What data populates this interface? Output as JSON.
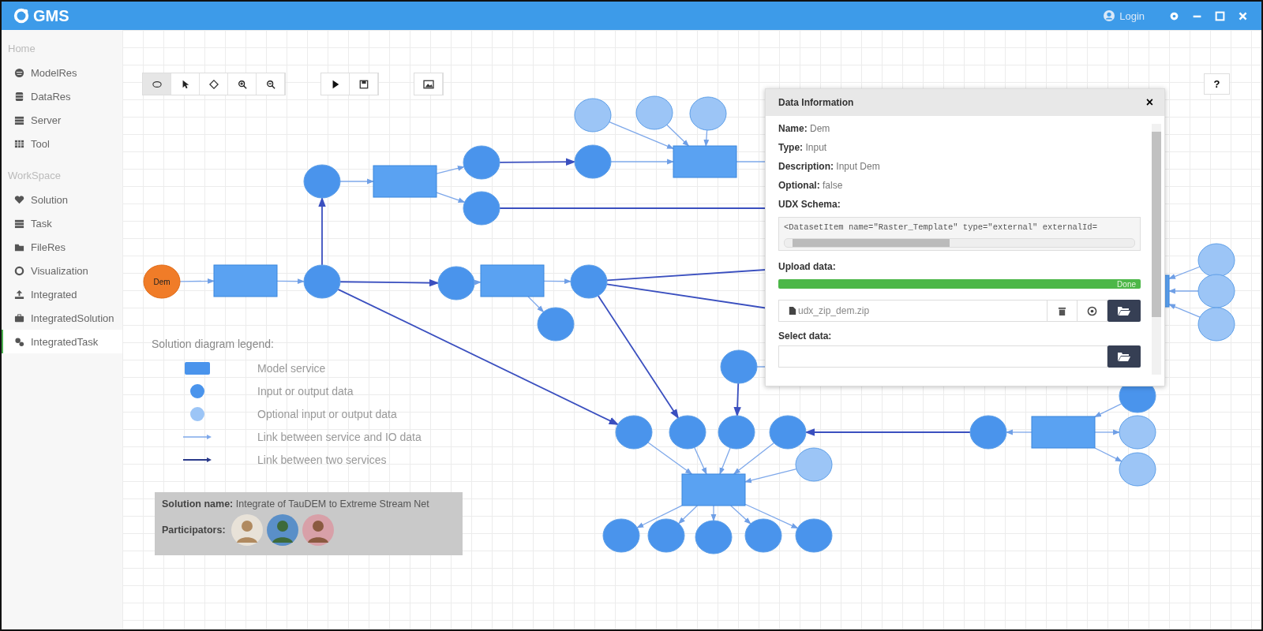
{
  "app": {
    "logo": "GMS",
    "login": "Login"
  },
  "sidebar": [
    {
      "title": "Home",
      "items": [
        {
          "label": "ModelRes",
          "selected": false
        },
        {
          "label": "DataRes",
          "selected": false
        },
        {
          "label": "Server",
          "selected": false
        },
        {
          "label": "Tool",
          "selected": false
        }
      ]
    },
    {
      "title": "WorkSpace",
      "items": [
        {
          "label": "Solution",
          "selected": false
        },
        {
          "label": "Task",
          "selected": false
        },
        {
          "label": "FileRes",
          "selected": false
        },
        {
          "label": "Visualization",
          "selected": false
        },
        {
          "label": "Integrated",
          "selected": false
        },
        {
          "label": "IntegratedSolution",
          "selected": false
        },
        {
          "label": "IntegratedTask",
          "selected": true
        }
      ]
    }
  ],
  "toolbar": {
    "tools": [
      {
        "selected": true
      },
      {
        "selected": false
      },
      {
        "selected": false
      },
      {
        "selected": false
      },
      {
        "selected": false
      }
    ],
    "help": "?"
  },
  "diagram": {
    "nodes": [
      {
        "kind": "input",
        "label": "Dem"
      },
      {
        "kind": "service"
      },
      {
        "kind": "data"
      },
      {
        "kind": "data"
      },
      {
        "kind": "service"
      },
      {
        "kind": "data"
      },
      {
        "kind": "data"
      },
      {
        "kind": "data"
      },
      {
        "kind": "optional"
      },
      {
        "kind": "optional"
      },
      {
        "kind": "optional"
      },
      {
        "kind": "service"
      },
      {
        "kind": "data"
      },
      {
        "kind": "service"
      },
      {
        "kind": "data"
      },
      {
        "kind": "data"
      },
      {
        "kind": "data"
      },
      {
        "kind": "data"
      },
      {
        "kind": "data"
      },
      {
        "kind": "data"
      },
      {
        "kind": "data"
      },
      {
        "kind": "optional"
      },
      {
        "kind": "service"
      },
      {
        "kind": "data"
      },
      {
        "kind": "data"
      },
      {
        "kind": "data"
      },
      {
        "kind": "data"
      },
      {
        "kind": "data"
      },
      {
        "kind": "data"
      },
      {
        "kind": "service"
      },
      {
        "kind": "data"
      },
      {
        "kind": "optional"
      },
      {
        "kind": "optional"
      },
      {
        "kind": "optional"
      },
      {
        "kind": "optional"
      },
      {
        "kind": "optional"
      },
      {
        "kind": "service"
      }
    ]
  },
  "legend": {
    "title": "Solution diagram legend:",
    "items": [
      {
        "kind": "service",
        "label": "Model service"
      },
      {
        "kind": "data",
        "label": "Input or output data"
      },
      {
        "kind": "optional",
        "label": "Optional input or output data"
      },
      {
        "kind": "io-link",
        "label": "Link between service and IO data"
      },
      {
        "kind": "service-link",
        "label": "Link between two services"
      }
    ]
  },
  "solution": {
    "name_label": "Solution name:",
    "name": "Integrate of TauDEM to Extreme Stream Net",
    "participators_label": "Participators:"
  },
  "dialog": {
    "title": "Data Information",
    "close": "×",
    "fields": [
      {
        "label": "Name:",
        "value": "Dem"
      },
      {
        "label": "Type:",
        "value": "Input"
      },
      {
        "label": "Description:",
        "value": "Input Dem"
      },
      {
        "label": "Optional:",
        "value": "false"
      }
    ],
    "schema_label": "UDX Schema:",
    "schema": "<DatasetItem name=\"Raster_Template\" type=\"external\" externalId=",
    "upload_label": "Upload data:",
    "progress": {
      "level": 1,
      "label": "Done"
    },
    "file": "udx_zip_dem.zip",
    "select_label": "Select data:"
  }
}
